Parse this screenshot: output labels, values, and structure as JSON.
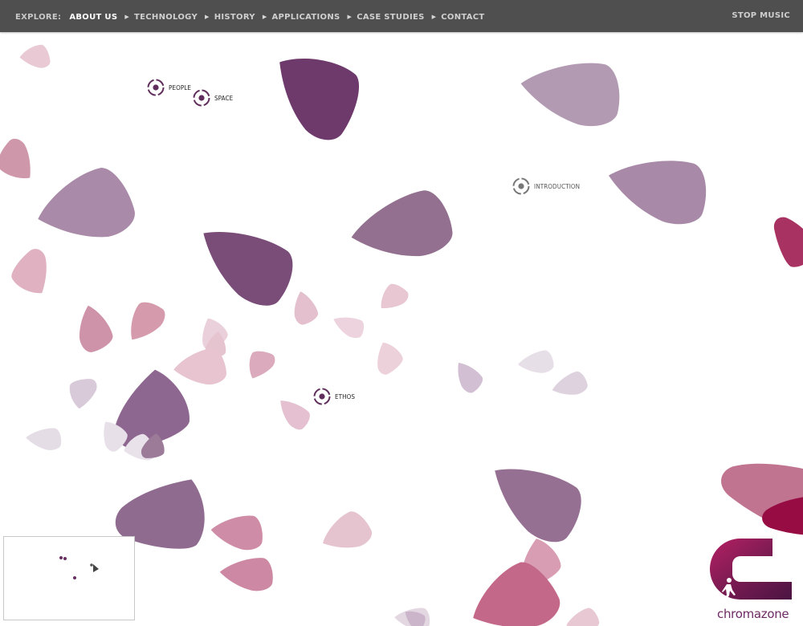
{
  "nav": {
    "lead": "EXPLORE:",
    "items": [
      {
        "label": "ABOUT US",
        "active": true
      },
      {
        "label": "TECHNOLOGY",
        "active": false
      },
      {
        "label": "HISTORY",
        "active": false
      },
      {
        "label": "APPLICATIONS",
        "active": false
      },
      {
        "label": "CASE STUDIES",
        "active": false
      },
      {
        "label": "CONTACT",
        "active": false
      }
    ],
    "stop_music": "STOP MUSIC"
  },
  "hotspots": {
    "people": "PEOPLE",
    "space": "SPACE",
    "introduction": "INTRODUCTION",
    "ethos": "ETHOS"
  },
  "brand": {
    "wordmark": "chromazone"
  },
  "colors": {
    "topbar": "#4f4f4f",
    "hotspot_dark": "#5f2e5c",
    "hotspot_muted": "#777777",
    "brand": "#6e2a64"
  }
}
